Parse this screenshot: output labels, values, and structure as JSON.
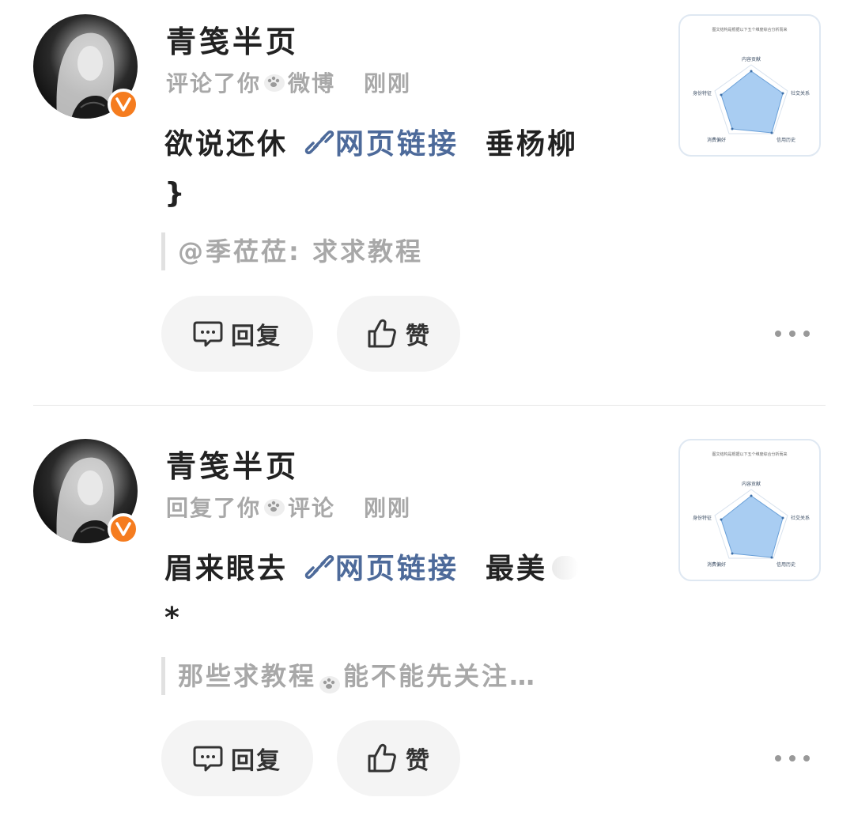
{
  "comments": [
    {
      "username": "青笺半页",
      "action": "评论了你",
      "action_target": "微博",
      "time": "刚刚",
      "text_before": "欲说还休",
      "link_label": "网页链接",
      "text_after": "垂杨柳 }",
      "quote": "@季莅莅:  求求教程",
      "reply_label": "回复",
      "like_label": "赞"
    },
    {
      "username": "青笺半页",
      "action": "回复了你",
      "action_target": "评论",
      "time": "刚刚",
      "text_before": "眉来眼去",
      "link_label": "网页链接",
      "text_after": "最美",
      "text_tail": "*",
      "quote_before": "那些求教程",
      "quote_after": "能不能先关注…",
      "reply_label": "回复",
      "like_label": "赞"
    }
  ],
  "thumbnail": {
    "caption": "图文结构是根据以下五个维度综合分析而来",
    "labels": [
      "内容贡献",
      "社交关系",
      "信用历史",
      "消费偏好",
      "身份特征"
    ]
  },
  "icons": {
    "verified": "verified-v-badge-icon",
    "paw_emoji": "paw-emoji-icon",
    "link": "link-chain-icon",
    "reply": "comment-bubble-icon",
    "like": "thumbs-up-icon",
    "more": "more-dots-icon"
  },
  "colors": {
    "link": "#4d6a9a",
    "verified_badge": "#f57c1f",
    "meta_text": "#a8a8a8",
    "button_bg": "#f4f4f4",
    "radar_fill": "#a9cdf2"
  }
}
